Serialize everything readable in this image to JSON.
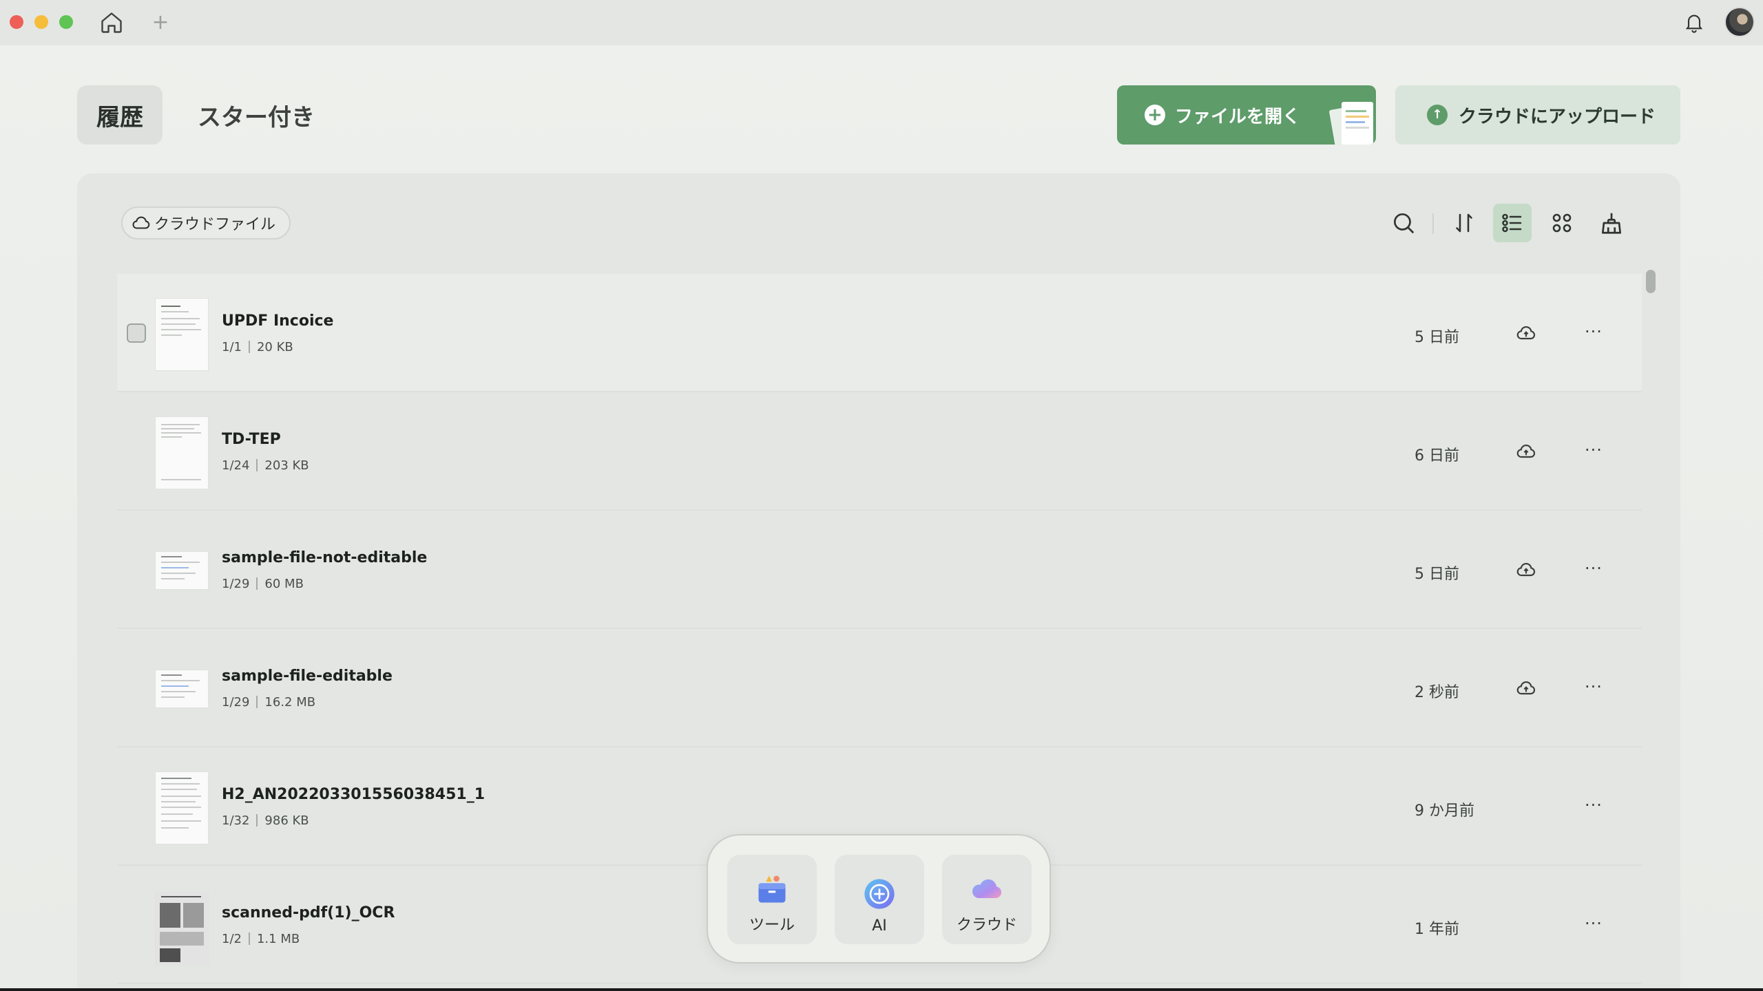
{
  "titlebar": {
    "add_tab_glyph": "+"
  },
  "header": {
    "tabs": [
      {
        "label": "履歴",
        "active": true
      },
      {
        "label": "スター付き",
        "active": false
      }
    ],
    "open_file_label": "ファイルを開く",
    "upload_label": "クラウドにアップロード"
  },
  "toolbar": {
    "cloud_files_label": "クラウドファイル",
    "view_mode": "list"
  },
  "files": [
    {
      "name": "UPDF Incoice",
      "pages": "1/1",
      "size": "20 KB",
      "date": "5 日前",
      "cloud": true
    },
    {
      "name": "TD-TEP",
      "pages": "1/24",
      "size": "203 KB",
      "date": "6 日前",
      "cloud": true
    },
    {
      "name": "sample-file-not-editable",
      "pages": "1/29",
      "size": "60 MB",
      "date": "5 日前",
      "cloud": true
    },
    {
      "name": "sample-file-editable",
      "pages": "1/29",
      "size": "16.2 MB",
      "date": "2 秒前",
      "cloud": true
    },
    {
      "name": "H2_AN202203301556038451_1",
      "pages": "1/32",
      "size": "986 KB",
      "date": "9 か月前",
      "cloud": false
    },
    {
      "name": "scanned-pdf(1)_OCR",
      "pages": "1/2",
      "size": "1.1 MB",
      "date": "1 年前",
      "cloud": false
    }
  ],
  "dock": [
    {
      "label": "ツール",
      "icon": "toolbox-icon"
    },
    {
      "label": "AI",
      "icon": "ai-icon"
    },
    {
      "label": "クラウド",
      "icon": "cloud-icon"
    }
  ],
  "colors": {
    "accent": "#5e9c6a",
    "accent_light": "#d9e4da",
    "active_view": "#c5dbc8"
  }
}
